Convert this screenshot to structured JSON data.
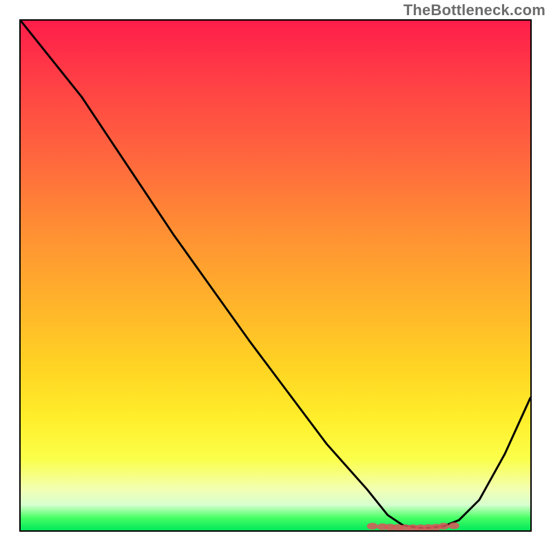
{
  "watermark": "TheBottleneck.com",
  "chart_data": {
    "type": "line",
    "title": "",
    "xlabel": "",
    "ylabel": "",
    "xlim": [
      0,
      100
    ],
    "ylim": [
      0,
      100
    ],
    "grid": false,
    "legend": false,
    "annotations": [],
    "series": [
      {
        "name": "bottleneck-curve",
        "color": "#000000",
        "x": [
          0,
          12,
          18,
          30,
          45,
          60,
          68,
          72,
          75,
          78,
          80,
          83,
          86,
          90,
          95,
          100
        ],
        "values": [
          100,
          85,
          76,
          58,
          37,
          17,
          8,
          3,
          1,
          0.5,
          0.5,
          0.8,
          2,
          6,
          15,
          26
        ]
      },
      {
        "name": "optimal-zone-markers",
        "color": "#d9575a",
        "type": "scatter",
        "x": [
          69,
          71,
          72.5,
          74,
          75.5,
          77,
          78.5,
          80,
          81.5,
          83,
          85
        ],
        "values": [
          0.8,
          0.7,
          0.6,
          0.55,
          0.5,
          0.5,
          0.5,
          0.55,
          0.6,
          0.8,
          0.9
        ]
      }
    ],
    "gradient_stops": [
      {
        "pos": 0,
        "color": "#ff1d4a"
      },
      {
        "pos": 0.28,
        "color": "#ff6a3d"
      },
      {
        "pos": 0.55,
        "color": "#ffb22b"
      },
      {
        "pos": 0.78,
        "color": "#ffee2a"
      },
      {
        "pos": 0.95,
        "color": "#d7ffcf"
      },
      {
        "pos": 1.0,
        "color": "#00e85a"
      }
    ]
  }
}
